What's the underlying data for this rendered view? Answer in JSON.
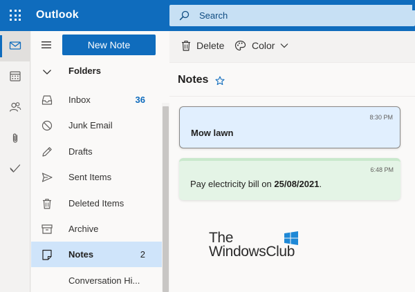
{
  "app": {
    "title": "Outlook"
  },
  "search": {
    "placeholder": "Search"
  },
  "rail": [
    {
      "icon": "mail-icon",
      "active": true
    },
    {
      "icon": "calendar-icon",
      "active": false
    },
    {
      "icon": "people-icon",
      "active": false
    },
    {
      "icon": "paperclip-icon",
      "active": false
    },
    {
      "icon": "todo-check-icon",
      "active": false
    }
  ],
  "toolbar": {
    "new_note": "New Note",
    "delete": "Delete",
    "color": "Color"
  },
  "folders": {
    "header": "Folders",
    "items": [
      {
        "icon": "inbox-icon",
        "label": "Inbox",
        "count": "36"
      },
      {
        "icon": "junk-icon",
        "label": "Junk Email",
        "count": ""
      },
      {
        "icon": "pencil-icon",
        "label": "Drafts",
        "count": ""
      },
      {
        "icon": "send-icon",
        "label": "Sent Items",
        "count": ""
      },
      {
        "icon": "trash-icon",
        "label": "Deleted Items",
        "count": ""
      },
      {
        "icon": "archive-icon",
        "label": "Archive",
        "count": ""
      },
      {
        "icon": "note-icon",
        "label": "Notes",
        "count": "2"
      },
      {
        "icon": "",
        "label": "Conversation Hi...",
        "count": ""
      }
    ]
  },
  "notes": {
    "title": "Notes",
    "items": [
      {
        "time": "8:30 PM",
        "text": "Mow lawn",
        "color": "#e1effe"
      },
      {
        "time": "6:48 PM",
        "text_before": "Pay electricity bill on ",
        "text_bold": "25/08/2021",
        "text_after": ".",
        "color": "#e4f4e6"
      }
    ]
  },
  "watermark": {
    "line1": "The",
    "line2": "WindowsClub"
  },
  "colors": {
    "brand": "#0f6cbd",
    "search_bg": "#c7e0f4",
    "selected_folder": "#cfe4fa"
  }
}
